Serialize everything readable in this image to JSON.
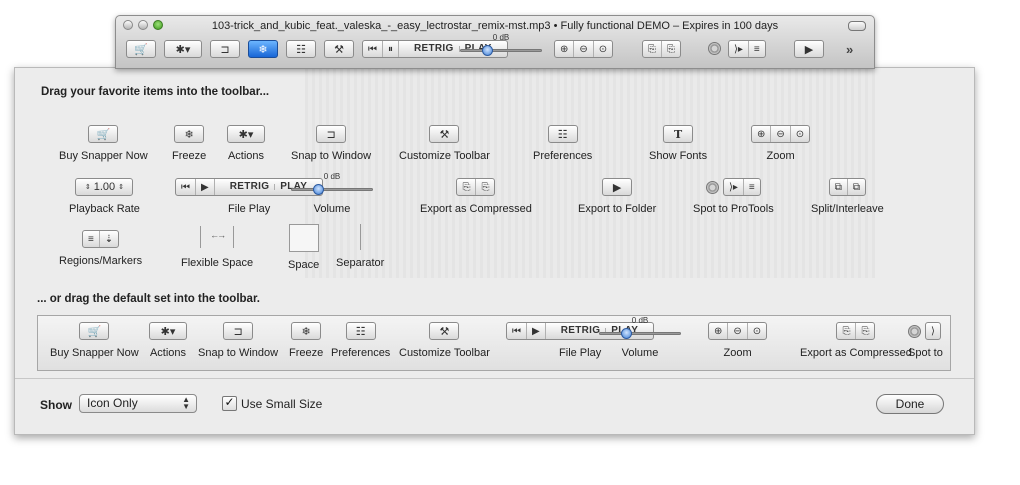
{
  "window": {
    "title": "103-trick_and_kubic_feat._valeska_-_easy_lectrostar_remix-mst.mp3 • Fully functional DEMO – Expires in 100 days",
    "volume_label": "0 dB",
    "overflow_glyph": "»"
  },
  "icons": {
    "cart": "🛒",
    "gear": "✱▾",
    "magnet": "⊐",
    "snow": "❄",
    "prefs": "☷",
    "hammer": "⚒",
    "rewind": "⏮",
    "play": "▶",
    "pause": "⏸",
    "zoom_in": "⊕",
    "zoom_out": "⊖",
    "zoom_fit": "⊙",
    "export": "⎘",
    "folder": "▶",
    "fonts": "T",
    "split": "⧉",
    "regions": "≡",
    "marker": "⇣"
  },
  "labels": {
    "retrig": "RETRIG",
    "play_small": "PLAY",
    "rate_value": "1.00"
  },
  "sheet": {
    "heading_favorites": "Drag your favorite items into the toolbar...",
    "heading_default": "... or drag the default set into the toolbar.",
    "favorites": [
      {
        "name": "buy-snapper-now",
        "label": "Buy Snapper Now"
      },
      {
        "name": "freeze",
        "label": "Freeze"
      },
      {
        "name": "actions",
        "label": "Actions"
      },
      {
        "name": "snap-to-window",
        "label": "Snap to Window"
      },
      {
        "name": "customize-toolbar",
        "label": "Customize Toolbar"
      },
      {
        "name": "preferences",
        "label": "Preferences"
      },
      {
        "name": "show-fonts",
        "label": "Show Fonts"
      },
      {
        "name": "zoom",
        "label": "Zoom"
      },
      {
        "name": "playback-rate",
        "label": "Playback Rate"
      },
      {
        "name": "file-play",
        "label": "File Play"
      },
      {
        "name": "volume",
        "label": "Volume"
      },
      {
        "name": "export-as-compressed",
        "label": "Export as Compressed"
      },
      {
        "name": "export-to-folder",
        "label": "Export to Folder"
      },
      {
        "name": "spot-to-protools",
        "label": "Spot to ProTools"
      },
      {
        "name": "split-interleave",
        "label": "Split/Interleave"
      },
      {
        "name": "regions-markers",
        "label": "Regions/Markers"
      },
      {
        "name": "flexible-space",
        "label": "Flexible Space"
      },
      {
        "name": "space",
        "label": "Space"
      },
      {
        "name": "separator",
        "label": "Separator"
      }
    ],
    "defaults": [
      {
        "name": "buy-snapper-now",
        "label": "Buy Snapper Now"
      },
      {
        "name": "actions",
        "label": "Actions"
      },
      {
        "name": "snap-to-window",
        "label": "Snap to Window"
      },
      {
        "name": "freeze",
        "label": "Freeze"
      },
      {
        "name": "preferences",
        "label": "Preferences"
      },
      {
        "name": "customize-toolbar",
        "label": "Customize Toolbar"
      },
      {
        "name": "file-play",
        "label": "File Play"
      },
      {
        "name": "volume",
        "label": "Volume"
      },
      {
        "name": "zoom",
        "label": "Zoom"
      },
      {
        "name": "export-as-compressed",
        "label": "Export as Compressed"
      },
      {
        "name": "spot-to",
        "label": "Spot to"
      }
    ],
    "show_label": "Show",
    "show_value": "Icon Only",
    "use_small_size_label": "Use Small Size",
    "use_small_size_checked": true,
    "done_label": "Done"
  },
  "colors": {
    "accent_blue": "#1866d6",
    "sheet_bg": "#ececec"
  }
}
